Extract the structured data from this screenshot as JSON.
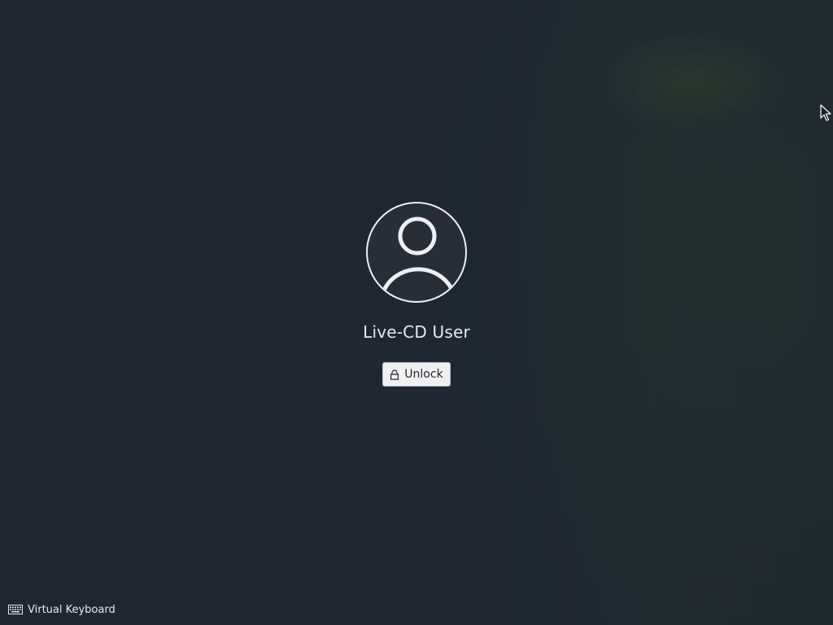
{
  "lockscreen": {
    "user_name": "Live-CD User",
    "unlock_label": "Unlock",
    "avatar_icon": "user-avatar-icon",
    "unlock_icon": "lock-icon"
  },
  "footer": {
    "virtual_keyboard_label": "Virtual Keyboard",
    "virtual_keyboard_icon": "keyboard-icon"
  },
  "colors": {
    "background": "#1e2732",
    "avatar_ring": "#eceff3",
    "button_bg": "#eff0f1",
    "text": "#e8eaee"
  }
}
